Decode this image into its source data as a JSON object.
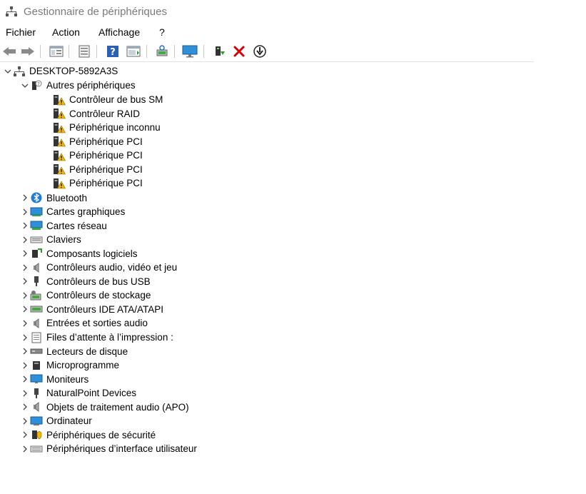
{
  "window": {
    "title": "Gestionnaire de périphériques"
  },
  "menu": {
    "items": [
      "Fichier",
      "Action",
      "Affichage",
      "?"
    ]
  },
  "tree": {
    "root": "DESKTOP-5892A3S",
    "other_devices": {
      "label": "Autres périphériques",
      "children": [
        "Contrôleur de bus SM",
        "Contrôleur RAID",
        "Périphérique inconnu",
        "Périphérique PCI",
        "Périphérique PCI",
        "Périphérique PCI",
        "Périphérique PCI"
      ]
    },
    "categories": [
      "Bluetooth",
      "Cartes graphiques",
      "Cartes réseau",
      "Claviers",
      "Composants logiciels",
      "Contrôleurs audio, vidéo et jeu",
      "Contrôleurs de bus USB",
      "Contrôleurs de stockage",
      "Contrôleurs IDE ATA/ATAPI",
      "Entrées et sorties audio",
      "Files d’attente à l’impression :",
      "Lecteurs de disque",
      "Microprogramme",
      "Moniteurs",
      "NaturalPoint Devices",
      "Objets de traitement audio (APO)",
      "Ordinateur",
      "Périphériques de sécurité",
      "Périphériques d’interface utilisateur"
    ]
  },
  "icons": {
    "title": "device-manager-icon",
    "warning_color": "#f2b700",
    "bluetooth_color": "#1f7bd8",
    "monitor_color": "#2f8fd8",
    "delete_color": "#d60000",
    "help_color": "#2a5fb5"
  }
}
